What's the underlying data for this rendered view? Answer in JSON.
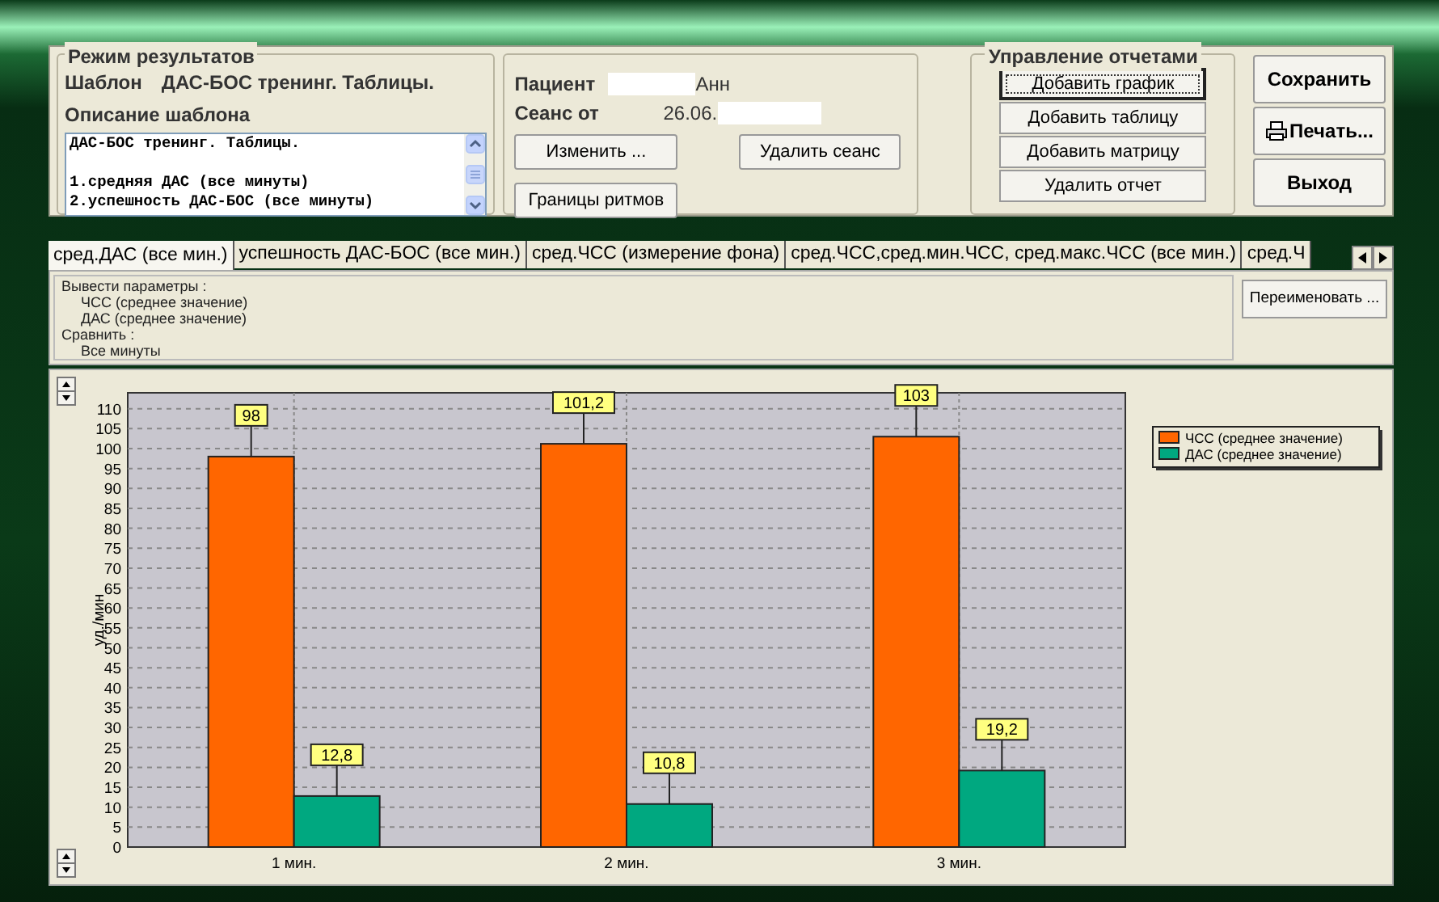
{
  "results_mode": {
    "title": "Режим результатов",
    "template_label": "Шаблон",
    "template_name": "ДАС-БОС тренинг. Таблицы.",
    "description_label": "Описание шаблона",
    "description_paragraphs": [
      {
        "lines": [
          "ДАС-БОС тренинг. Таблицы."
        ]
      },
      {
        "lines": [
          "1.средняя ДАС (все минуты)",
          "2.успешность ДАС-БОС (все минуты)"
        ]
      }
    ]
  },
  "session": {
    "patient_label": "Пациент",
    "patient_value": "Анн",
    "session_label": "Сеанс от",
    "session_value": "26.06.",
    "buttons": [
      "Изменить ...",
      "Удалить сеанс",
      "Границы ритмов"
    ]
  },
  "report_management": {
    "title": "Управление отчетами",
    "buttons": [
      {
        "label": "Добавить график",
        "focused": true
      },
      {
        "label": "Добавить таблицу",
        "focused": false
      },
      {
        "label": "Добавить матрицу",
        "focused": false
      },
      {
        "label": "Удалить отчет",
        "focused": false
      }
    ]
  },
  "main_buttons": [
    {
      "label": "Сохранить",
      "kind": "plain"
    },
    {
      "label": "Печать...",
      "kind": "print"
    },
    {
      "label": "Выход",
      "kind": "plain"
    }
  ],
  "tabs": [
    {
      "label": "сред.ДАС (все мин.)",
      "selected": true
    },
    {
      "label": "успешность ДАС-БОС (все мин.)",
      "selected": false
    },
    {
      "label": "сред.ЧСС (измерение фона)",
      "selected": false
    },
    {
      "label": "сред.ЧСС,сред.мин.ЧСС, сред.макс.ЧСС (все мин.)",
      "selected": false
    },
    {
      "label": "сред.Ч",
      "selected": false
    }
  ],
  "report_info": {
    "items": [
      {
        "text": "Вывести параметры :",
        "children": [
          {
            "text": "ЧСС (среднее значение)"
          },
          {
            "text": "ДАС (среднее значение)"
          }
        ]
      },
      {
        "text": "Сравнить :",
        "children": [
          {
            "text": "Все минуты"
          }
        ]
      }
    ],
    "rename_button": "Переименовать ..."
  },
  "chart": {
    "chart_data": {
      "type": "bar",
      "ylabel": "уд./мин",
      "categories": [
        "1 мин.",
        "2 мин.",
        "3 мин."
      ],
      "series": [
        {
          "name": "ЧСС (среднее значение)",
          "color": "#ff6600",
          "values": [
            98,
            101.2,
            103
          ]
        },
        {
          "name": "ДАС (среднее значение)",
          "color": "#00a880",
          "values": [
            12.8,
            10.8,
            19.2
          ]
        }
      ],
      "ylim": [
        0,
        114
      ],
      "yticks": [
        0,
        5,
        10,
        15,
        20,
        25,
        30,
        35,
        40,
        45,
        50,
        55,
        60,
        65,
        70,
        75,
        80,
        85,
        90,
        95,
        100,
        105,
        110
      ],
      "grid": true,
      "legend": "right",
      "value_labels": [
        [
          "98",
          "101,2",
          "103"
        ],
        [
          "12,8",
          "10,8",
          "19,2"
        ]
      ]
    }
  }
}
